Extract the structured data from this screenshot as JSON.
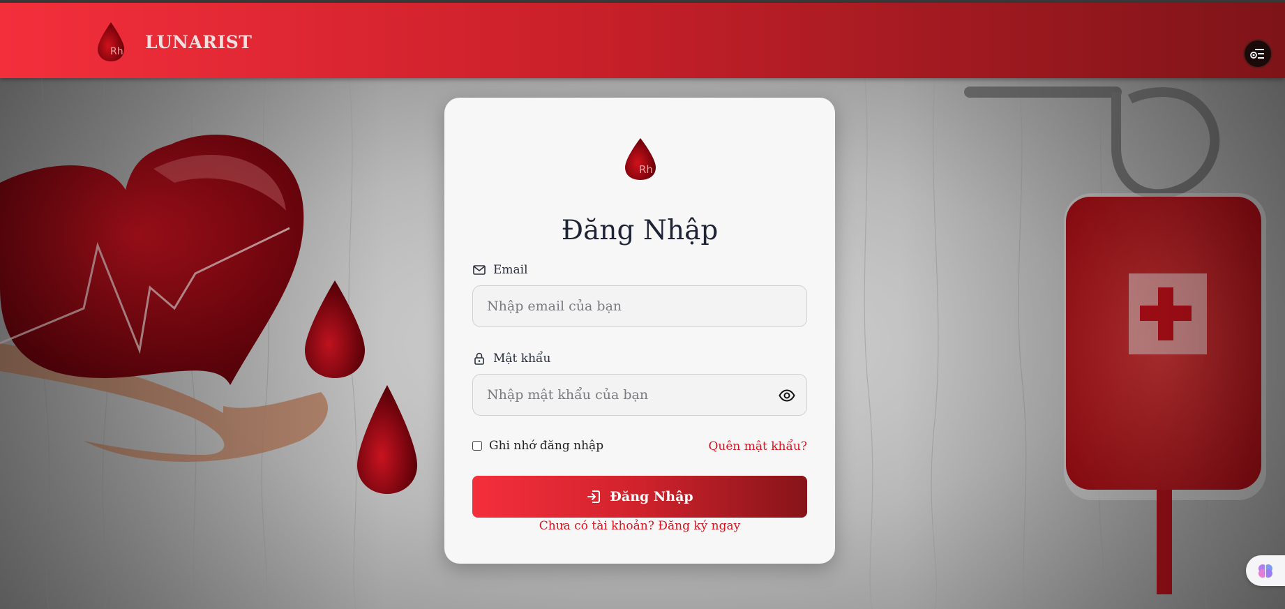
{
  "header": {
    "brand_name": "LUNARIST",
    "logo_text": "Rh",
    "menu_icon": "user-menu-icon"
  },
  "login_card": {
    "logo_text": "Rh",
    "title": "Đăng Nhập",
    "email": {
      "label": "Email",
      "placeholder": "Nhập email của bạn",
      "value": ""
    },
    "password": {
      "label": "Mật khẩu",
      "placeholder": "Nhập mật khẩu của bạn",
      "value": ""
    },
    "remember_label": "Ghi nhớ đăng nhập",
    "remember_checked": false,
    "forgot_link": "Quên mật khẩu?",
    "submit_label": "Đăng Nhập",
    "register_link": "Chưa có tài khoản? Đăng ký ngay"
  },
  "colors": {
    "primary": "#f42f3c",
    "primary_dark": "#861419",
    "link": "#d8121f",
    "card_bg": "#f7f7f7"
  }
}
